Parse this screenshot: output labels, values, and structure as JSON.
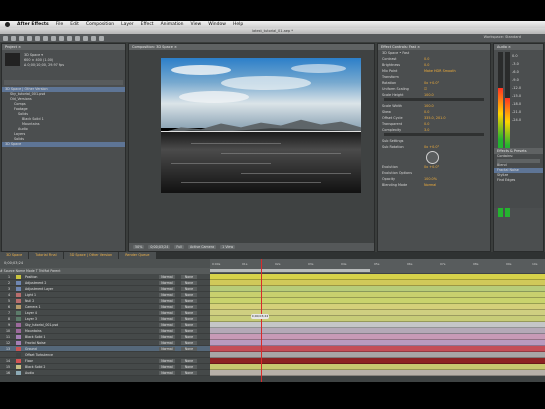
{
  "menubar": {
    "items": [
      "After Effects",
      "File",
      "Edit",
      "Composition",
      "Layer",
      "Effect",
      "Animation",
      "View",
      "Window",
      "Help"
    ]
  },
  "window": {
    "title": "latest_tutorial_01.aep *"
  },
  "toolbar": {
    "workspace": "Workspace: Standard"
  },
  "project": {
    "tab": "Project ×",
    "info": [
      "3D Space ▾",
      "600 × 400 (1.00)",
      "Δ 0;00;10;00, 29.97 fps"
    ],
    "items": [
      {
        "name": "3D Space | Other Version",
        "selected": true
      },
      {
        "name": "Sky_tutorial_001.psd"
      },
      {
        "name": "Old_Versions"
      },
      {
        "name": "Comps"
      },
      {
        "name": "Footage"
      },
      {
        "name": "Solids"
      },
      {
        "name": "Black Solid 1"
      },
      {
        "name": "Mountains"
      },
      {
        "name": "Audio"
      },
      {
        "name": "Layers"
      },
      {
        "name": "Solids"
      },
      {
        "name": "3D Space",
        "selected": true
      }
    ]
  },
  "composition": {
    "tab": "Composition: 3D Space ×",
    "zoom": "50%",
    "timecode": "0;00;03;24",
    "resolution": "Full",
    "camera": "Active Camera",
    "view": "1 View"
  },
  "effects": {
    "tab": "Effect Controls: Fast ×",
    "rows": [
      {
        "label": "3D Space • Fast",
        "value": ""
      },
      {
        "label": "Contrast",
        "value": "0.0"
      },
      {
        "label": "Brightness",
        "value": "0.0"
      },
      {
        "label": "Mix Point",
        "value": "Make HDR Smooth"
      },
      {
        "label": "Transform",
        "value": ""
      },
      {
        "label": "Rotation",
        "value": "0x +0.0°"
      },
      {
        "label": "Uniform Scaling",
        "value": "☑"
      },
      {
        "label": "Scale Height",
        "value": "100.0"
      },
      {
        "label": "Scale Width",
        "value": "100.0"
      },
      {
        "label": "Skew",
        "value": "0.0"
      },
      {
        "label": "Offset Cycle",
        "value": "335.0, 201.0"
      },
      {
        "label": "Transparent",
        "value": "0.0"
      },
      {
        "label": "Complexity",
        "value": "3.0"
      },
      {
        "label": "Sub Settings",
        "value": ""
      },
      {
        "label": "Sub Rotation",
        "value": "0x +0.0°"
      },
      {
        "label": "Evolution",
        "value": "0x +0.0°"
      },
      {
        "label": "Evolution Options",
        "value": ""
      },
      {
        "label": "Opacity",
        "value": "100.0%"
      },
      {
        "label": "Blending Mode",
        "value": "Normal"
      }
    ]
  },
  "audio": {
    "tab": "Audio ×",
    "db_labels": [
      "0.0",
      "-3.0",
      "-6.0",
      "-9.0",
      "-12.0",
      "-15.0",
      "-18.0",
      "-21.0",
      "-24.0"
    ],
    "levels": [
      0.78,
      0.72
    ]
  },
  "right_panel": {
    "tab": "Effects & Presets",
    "items": [
      "Contains:",
      "Blend",
      "Fractal Noise",
      "Stylize",
      "Find Edges"
    ]
  },
  "timeline": {
    "tabs": [
      "3D Space",
      "Tutorial Final",
      "3D Space | Other Version",
      "Render Queue"
    ],
    "timecode": "0;00;03;24",
    "column_header": "#  Source Name        Mode  T TrkMat  Parent",
    "ruler_ticks": [
      "0:00s",
      "01s",
      "02s",
      "03s",
      "04s",
      "05s",
      "06s",
      "07s",
      "08s",
      "09s",
      "10s"
    ],
    "cursor_label": "0;00;03;24",
    "layers": [
      {
        "num": "1",
        "name": "Position",
        "mode": "Normal",
        "tmat": "None",
        "color": "#c9c43e",
        "bar": "#d7d24a"
      },
      {
        "num": "2",
        "name": "Adjustment 2",
        "mode": "Normal",
        "tmat": "None",
        "color": "#6f87b2",
        "bar": "#d0c95a"
      },
      {
        "num": "3",
        "name": "Adjustment Layer",
        "mode": "Normal",
        "tmat": "None",
        "color": "#6f87b2",
        "bar": "#b7cc7a"
      },
      {
        "num": "4",
        "name": "Light 1",
        "mode": "Normal",
        "tmat": "None",
        "color": "#b86d6d",
        "bar": "#c8d06e"
      },
      {
        "num": "5",
        "name": "Null 2",
        "mode": "Normal",
        "tmat": "None",
        "color": "#b86d6d",
        "bar": "#c9d36d"
      },
      {
        "num": "6",
        "name": "Camera 1",
        "mode": "Normal",
        "tmat": "None",
        "color": "#b59b6b",
        "bar": "#d4d07a"
      },
      {
        "num": "7",
        "name": "Layer 4",
        "mode": "Normal",
        "tmat": "None",
        "color": "#5c7c6a",
        "bar": "#cfcf81"
      },
      {
        "num": "8",
        "name": "Layer 3",
        "mode": "Normal",
        "tmat": "None",
        "color": "#5c7c6a",
        "bar": "#c7cc78"
      },
      {
        "num": "9",
        "name": "Sky_tutorial_001.psd",
        "mode": "Normal",
        "tmat": "None",
        "color": "#9c6a9c",
        "bar": "#c4c6c7"
      },
      {
        "num": "10",
        "name": "Mountains",
        "mode": "Normal",
        "tmat": "None",
        "color": "#9c6a9c",
        "bar": "#b4a9b7"
      },
      {
        "num": "11",
        "name": "Black Solid 1",
        "mode": "Normal",
        "tmat": "None",
        "color": "#a57fb6",
        "bar": "#c79ab6"
      },
      {
        "num": "12",
        "name": "Fractal Noise",
        "mode": "Normal",
        "tmat": "None",
        "color": "#a57fb6",
        "bar": "#b99bbf"
      },
      {
        "num": "13",
        "name": "Ground",
        "mode": "Normal",
        "tmat": "None",
        "color": "#c95454",
        "bar": "#c44e57",
        "selected": true
      },
      {
        "num": "",
        "name": "Offset Turbulence",
        "mode": "",
        "tmat": "",
        "color": "#3f4343",
        "bar": "#a8a6a6"
      },
      {
        "num": "14",
        "name": "Floor",
        "mode": "Normal",
        "tmat": "None",
        "color": "#d45454",
        "bar": "#8c2222"
      },
      {
        "num": "15",
        "name": "Black Solid 2",
        "mode": "Normal",
        "tmat": "None",
        "color": "#c6bf86",
        "bar": "#c7c86f"
      },
      {
        "num": "16",
        "name": "Audio",
        "mode": "Normal",
        "tmat": "None",
        "color": "#8daab5",
        "bar": "#b7b0a8"
      }
    ]
  }
}
